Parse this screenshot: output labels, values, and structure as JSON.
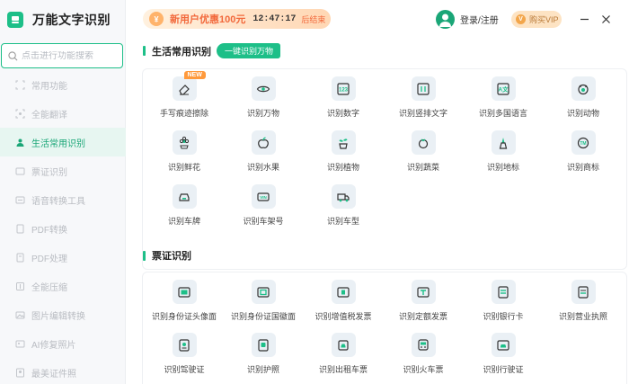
{
  "app": {
    "title": "万能文字识别"
  },
  "search": {
    "placeholder": "点击进行功能搜索"
  },
  "sidebar": {
    "items": [
      {
        "label": "常用功能",
        "active": false
      },
      {
        "label": "全能翻译",
        "active": false
      },
      {
        "label": "生活常用识别",
        "active": true
      },
      {
        "label": "票证识别",
        "active": false
      },
      {
        "label": "语音转换工具",
        "active": false
      },
      {
        "label": "PDF转换",
        "active": false
      },
      {
        "label": "PDF处理",
        "active": false
      },
      {
        "label": "全能压缩",
        "active": false
      },
      {
        "label": "图片编辑转换",
        "active": false
      },
      {
        "label": "AI修复照片",
        "active": false
      },
      {
        "label": "最美证件照",
        "active": false
      }
    ]
  },
  "header": {
    "promo_text": "新用户优惠100元",
    "promo_time": "12:47:17",
    "promo_end": "后结束",
    "user_label": "登录/注册",
    "vip_label": "购买VIP"
  },
  "sections": {
    "life": {
      "title": "生活常用识别",
      "tag": "一键识别万物",
      "items": [
        {
          "label": "手写痕迹擦除",
          "icon": "eraser-icon",
          "badge": "NEW"
        },
        {
          "label": "识别万物",
          "icon": "eye-icon"
        },
        {
          "label": "识别数字",
          "icon": "number-icon"
        },
        {
          "label": "识别竖排文字",
          "icon": "vertical-text-icon"
        },
        {
          "label": "识别多国语言",
          "icon": "language-icon"
        },
        {
          "label": "识别动物",
          "icon": "animal-icon"
        },
        {
          "label": "识别鲜花",
          "icon": "flower-icon"
        },
        {
          "label": "识别水果",
          "icon": "fruit-icon"
        },
        {
          "label": "识别植物",
          "icon": "plant-icon"
        },
        {
          "label": "识别蔬菜",
          "icon": "vegetable-icon"
        },
        {
          "label": "识别地标",
          "icon": "landmark-icon"
        },
        {
          "label": "识别商标",
          "icon": "trademark-icon"
        },
        {
          "label": "识别车牌",
          "icon": "license-plate-icon"
        },
        {
          "label": "识别车架号",
          "icon": "vin-icon"
        },
        {
          "label": "识别车型",
          "icon": "car-model-icon"
        }
      ]
    },
    "tickets": {
      "title": "票证识别",
      "items": [
        {
          "label": "识别身份证头像面",
          "icon": "id-card-front-icon"
        },
        {
          "label": "识别身份证国徽面",
          "icon": "id-card-back-icon"
        },
        {
          "label": "识别增值税发票",
          "icon": "vat-invoice-icon"
        },
        {
          "label": "识别定额发票",
          "icon": "quota-invoice-icon"
        },
        {
          "label": "识别银行卡",
          "icon": "bank-card-icon"
        },
        {
          "label": "识别营业执照",
          "icon": "business-license-icon"
        },
        {
          "label": "识别驾驶证",
          "icon": "driver-license-icon"
        },
        {
          "label": "识别护照",
          "icon": "passport-icon"
        },
        {
          "label": "识别出租车票",
          "icon": "taxi-ticket-icon"
        },
        {
          "label": "识别火车票",
          "icon": "train-ticket-icon"
        },
        {
          "label": "识别行驶证",
          "icon": "vehicle-license-icon"
        }
      ]
    }
  },
  "colors": {
    "accent": "#1dbf88",
    "active_bg": "#e7f6f1",
    "promo": "#f2683b",
    "vip_bg": "#fde3c3"
  }
}
